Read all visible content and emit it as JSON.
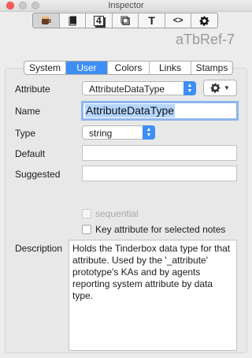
{
  "window": {
    "title": "Inspector"
  },
  "icon_tabs": [
    {
      "name": "general-tab",
      "icon": "coffee-cup-icon"
    },
    {
      "name": "text-tab",
      "icon": "note-page-icon"
    },
    {
      "name": "properties-tab",
      "label": "4"
    },
    {
      "name": "appearance-tab",
      "icon": "box-icon"
    },
    {
      "name": "text-style-tab",
      "label": "T"
    },
    {
      "name": "action-tab",
      "label": "<>"
    },
    {
      "name": "settings-tab",
      "icon": "gear-icon"
    }
  ],
  "note_title": "aTbRef-7",
  "tabs": [
    "System",
    "User",
    "Colors",
    "Links",
    "Stamps"
  ],
  "selected_tab": "User",
  "form": {
    "attribute_label": "Attribute",
    "attribute_value": "AttributeDataType",
    "name_label": "Name",
    "name_value": "AttributeDataType",
    "type_label": "Type",
    "type_value": "string",
    "default_label": "Default",
    "default_value": "",
    "suggested_label": "Suggested",
    "suggested_value": "",
    "sequential_label": "sequential",
    "key_attribute_label": "Key attribute for selected notes",
    "description_label": "Description",
    "description_value": "Holds the Tinderbox data type for that attribute. Used by the '_attribute' prototype's KAs and by agents reporting system attribute by data type."
  },
  "colors": {
    "accent": "#3d8ef5",
    "close": "#fc5f57"
  }
}
